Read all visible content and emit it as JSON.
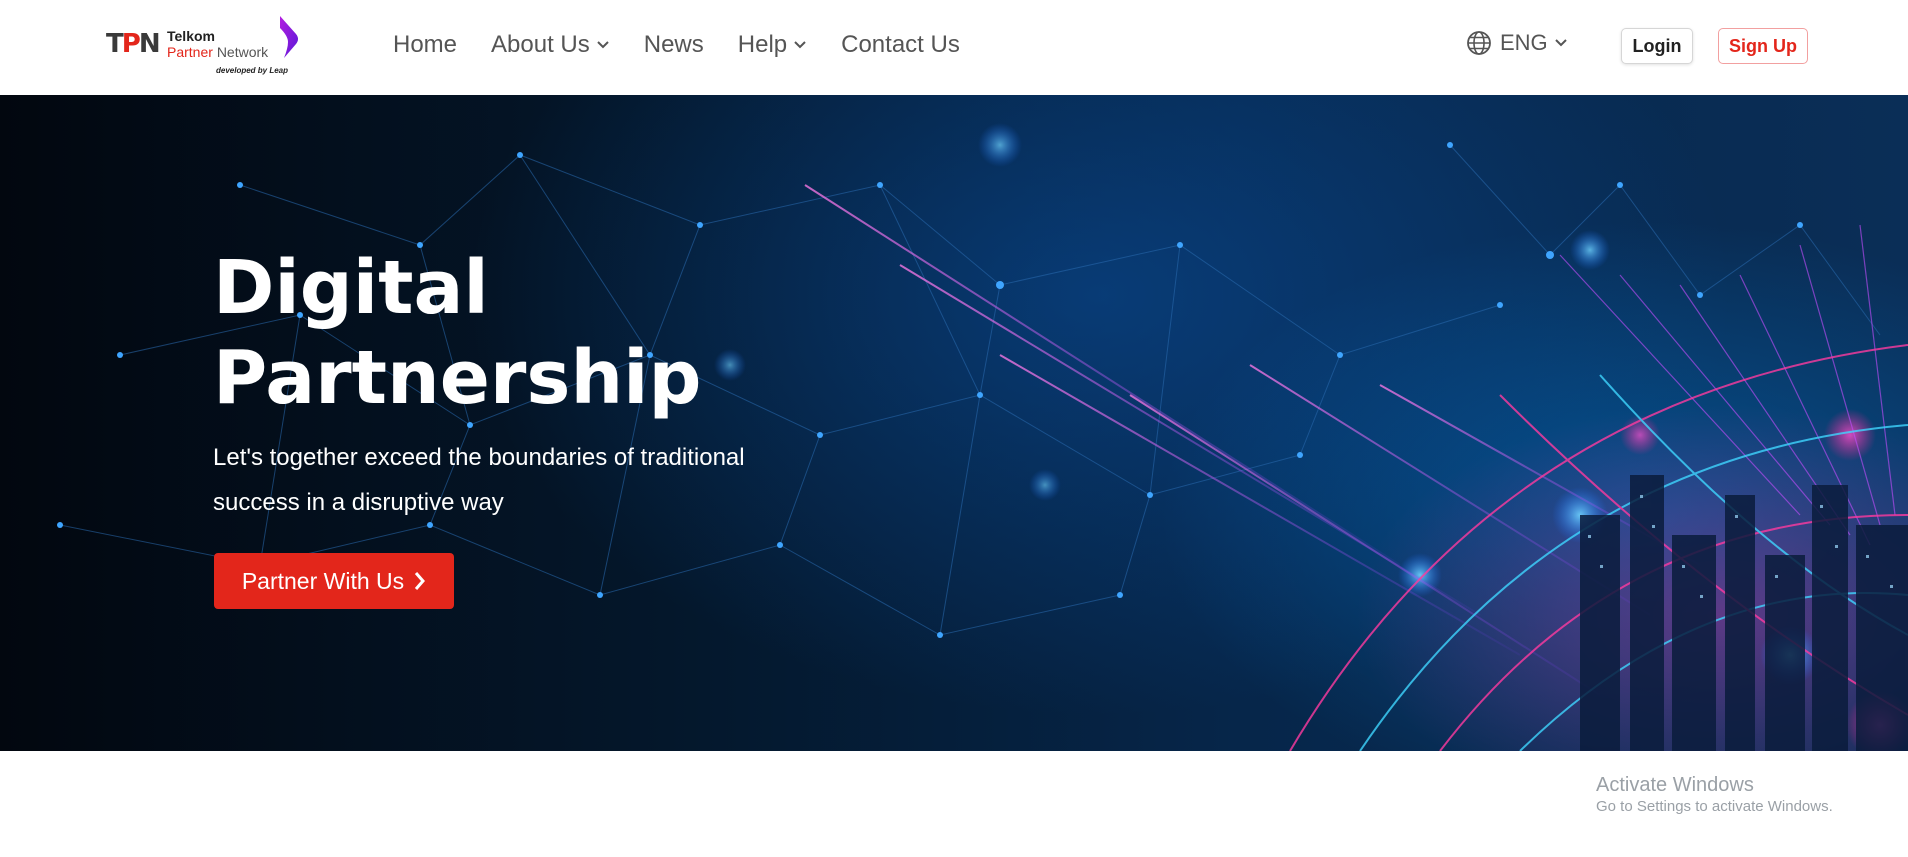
{
  "header": {
    "logo": {
      "mark_t": "T",
      "mark_p": "P",
      "mark_n": "N",
      "line1": "Telkom",
      "line2_red": "Partner",
      "line2_grey": "Network",
      "developed": "developed by Leap"
    },
    "nav": [
      {
        "label": "Home",
        "has_dropdown": false
      },
      {
        "label": "About Us",
        "has_dropdown": true
      },
      {
        "label": "News",
        "has_dropdown": false
      },
      {
        "label": "Help",
        "has_dropdown": true
      },
      {
        "label": "Contact Us",
        "has_dropdown": false
      }
    ],
    "language": {
      "label": "ENG",
      "icon": "globe-icon"
    },
    "login_label": "Login",
    "signup_label": "Sign Up"
  },
  "hero": {
    "title_line1": "Digital",
    "title_line2": "Partnership",
    "subtitle_line1": "Let's together exceed the boundaries of traditional",
    "subtitle_line2": "success in a disruptive way",
    "cta_label": "Partner With Us"
  },
  "watermark": {
    "line1": "Activate Windows",
    "line2": "Go to Settings to activate Windows."
  },
  "colors": {
    "brand_red": "#e3261b",
    "nav_text": "#555555",
    "hero_dark": "#04172b"
  }
}
